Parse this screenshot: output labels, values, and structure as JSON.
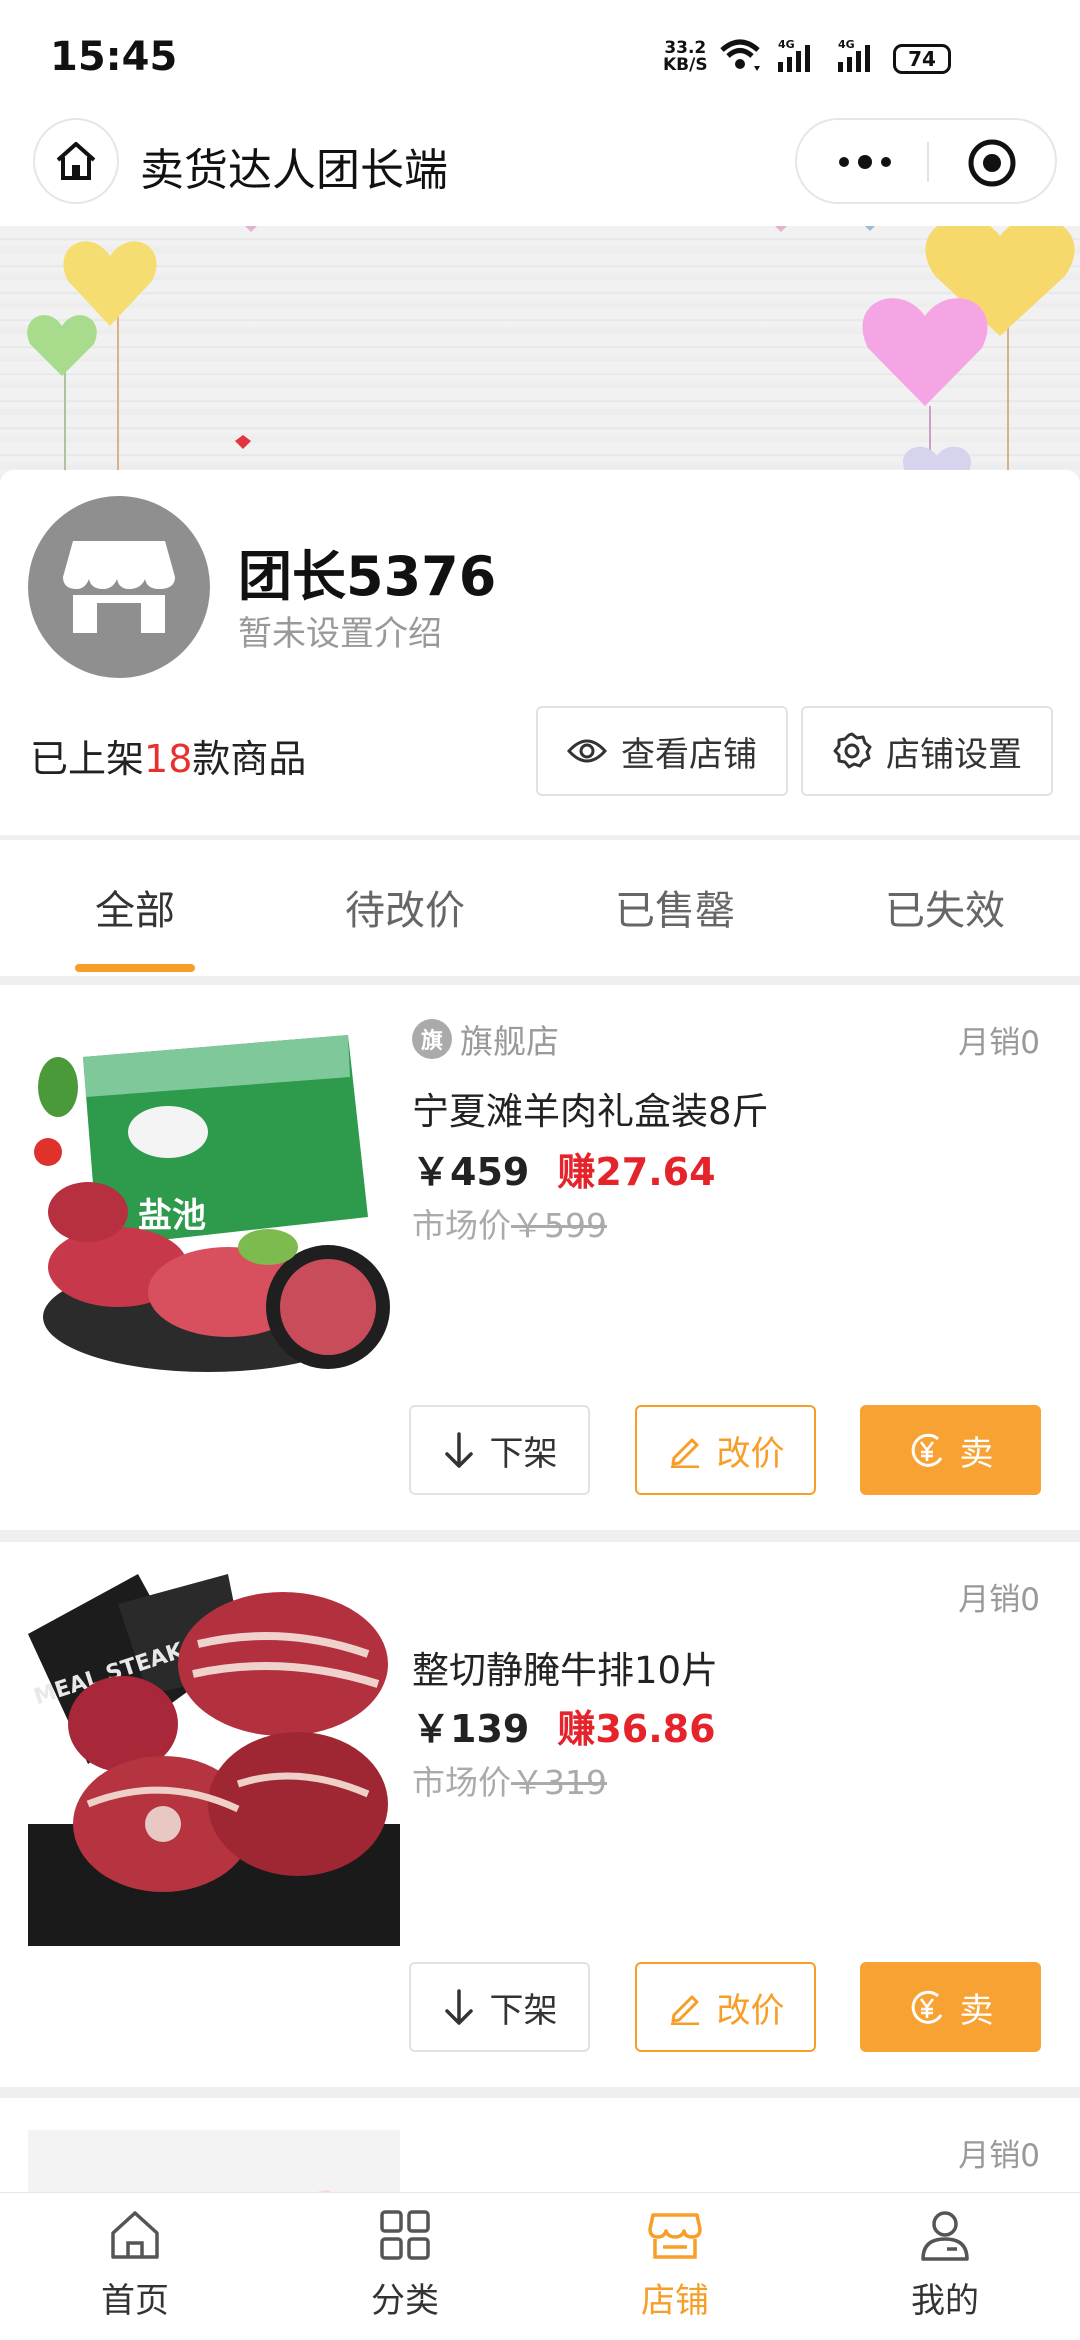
{
  "status_bar": {
    "time": "15:45",
    "net_speed_value": "33.2",
    "net_speed_unit": "KB/S",
    "battery": "74"
  },
  "nav": {
    "title": "卖货达人团长端"
  },
  "shop": {
    "name": "团长5376",
    "description": "暂未设置介绍",
    "listed_prefix": "已上架",
    "listed_count": "18",
    "listed_suffix": "款商品",
    "view_label": "查看店铺",
    "settings_label": "店铺设置"
  },
  "tabs": [
    {
      "label": "全部",
      "active": true
    },
    {
      "label": "待改价",
      "active": false
    },
    {
      "label": "已售罄",
      "active": false
    },
    {
      "label": "已失效",
      "active": false
    }
  ],
  "products": [
    {
      "store_badge": "旗",
      "store_tag": "旗舰店",
      "sales": "月销0",
      "name": "宁夏滩羊肉礼盒装8斤",
      "price": "￥459",
      "earn": "赚27.64",
      "market_label": "市场价",
      "market_price": "￥599",
      "box_text": "盐池"
    },
    {
      "sales": "月销0",
      "name": "整切静腌牛排10片",
      "price": "￥139",
      "earn": "赚36.86",
      "market_label": "市场价",
      "market_price": "￥319",
      "box_text": "MEAL STEAK"
    },
    {
      "sales": "月销0"
    }
  ],
  "product_actions": {
    "off_label": "下架",
    "edit_label": "改价",
    "sell_label": "卖"
  },
  "tabbar": [
    {
      "label": "首页",
      "icon": "home-icon",
      "active": false
    },
    {
      "label": "分类",
      "icon": "category-icon",
      "active": false
    },
    {
      "label": "店铺",
      "icon": "store-icon",
      "active": true
    },
    {
      "label": "我的",
      "icon": "profile-icon",
      "active": false
    }
  ],
  "colors": {
    "accent": "#f79e28",
    "earn": "#e5232a",
    "highlight": "#e8312f"
  }
}
